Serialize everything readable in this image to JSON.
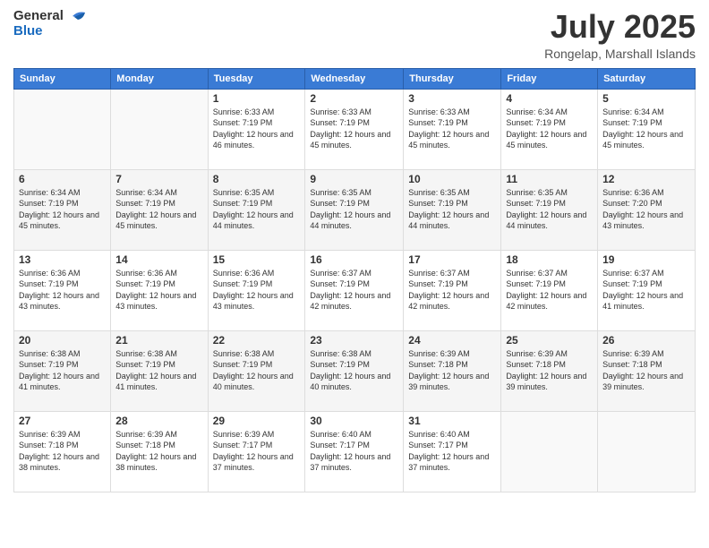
{
  "header": {
    "logo_general": "General",
    "logo_blue": "Blue",
    "month_title": "July 2025",
    "location": "Rongelap, Marshall Islands"
  },
  "days_of_week": [
    "Sunday",
    "Monday",
    "Tuesday",
    "Wednesday",
    "Thursday",
    "Friday",
    "Saturday"
  ],
  "weeks": [
    [
      {
        "day": "",
        "info": ""
      },
      {
        "day": "",
        "info": ""
      },
      {
        "day": "1",
        "info": "Sunrise: 6:33 AM\nSunset: 7:19 PM\nDaylight: 12 hours and 46 minutes."
      },
      {
        "day": "2",
        "info": "Sunrise: 6:33 AM\nSunset: 7:19 PM\nDaylight: 12 hours and 45 minutes."
      },
      {
        "day": "3",
        "info": "Sunrise: 6:33 AM\nSunset: 7:19 PM\nDaylight: 12 hours and 45 minutes."
      },
      {
        "day": "4",
        "info": "Sunrise: 6:34 AM\nSunset: 7:19 PM\nDaylight: 12 hours and 45 minutes."
      },
      {
        "day": "5",
        "info": "Sunrise: 6:34 AM\nSunset: 7:19 PM\nDaylight: 12 hours and 45 minutes."
      }
    ],
    [
      {
        "day": "6",
        "info": "Sunrise: 6:34 AM\nSunset: 7:19 PM\nDaylight: 12 hours and 45 minutes."
      },
      {
        "day": "7",
        "info": "Sunrise: 6:34 AM\nSunset: 7:19 PM\nDaylight: 12 hours and 45 minutes."
      },
      {
        "day": "8",
        "info": "Sunrise: 6:35 AM\nSunset: 7:19 PM\nDaylight: 12 hours and 44 minutes."
      },
      {
        "day": "9",
        "info": "Sunrise: 6:35 AM\nSunset: 7:19 PM\nDaylight: 12 hours and 44 minutes."
      },
      {
        "day": "10",
        "info": "Sunrise: 6:35 AM\nSunset: 7:19 PM\nDaylight: 12 hours and 44 minutes."
      },
      {
        "day": "11",
        "info": "Sunrise: 6:35 AM\nSunset: 7:19 PM\nDaylight: 12 hours and 44 minutes."
      },
      {
        "day": "12",
        "info": "Sunrise: 6:36 AM\nSunset: 7:20 PM\nDaylight: 12 hours and 43 minutes."
      }
    ],
    [
      {
        "day": "13",
        "info": "Sunrise: 6:36 AM\nSunset: 7:19 PM\nDaylight: 12 hours and 43 minutes."
      },
      {
        "day": "14",
        "info": "Sunrise: 6:36 AM\nSunset: 7:19 PM\nDaylight: 12 hours and 43 minutes."
      },
      {
        "day": "15",
        "info": "Sunrise: 6:36 AM\nSunset: 7:19 PM\nDaylight: 12 hours and 43 minutes."
      },
      {
        "day": "16",
        "info": "Sunrise: 6:37 AM\nSunset: 7:19 PM\nDaylight: 12 hours and 42 minutes."
      },
      {
        "day": "17",
        "info": "Sunrise: 6:37 AM\nSunset: 7:19 PM\nDaylight: 12 hours and 42 minutes."
      },
      {
        "day": "18",
        "info": "Sunrise: 6:37 AM\nSunset: 7:19 PM\nDaylight: 12 hours and 42 minutes."
      },
      {
        "day": "19",
        "info": "Sunrise: 6:37 AM\nSunset: 7:19 PM\nDaylight: 12 hours and 41 minutes."
      }
    ],
    [
      {
        "day": "20",
        "info": "Sunrise: 6:38 AM\nSunset: 7:19 PM\nDaylight: 12 hours and 41 minutes."
      },
      {
        "day": "21",
        "info": "Sunrise: 6:38 AM\nSunset: 7:19 PM\nDaylight: 12 hours and 41 minutes."
      },
      {
        "day": "22",
        "info": "Sunrise: 6:38 AM\nSunset: 7:19 PM\nDaylight: 12 hours and 40 minutes."
      },
      {
        "day": "23",
        "info": "Sunrise: 6:38 AM\nSunset: 7:19 PM\nDaylight: 12 hours and 40 minutes."
      },
      {
        "day": "24",
        "info": "Sunrise: 6:39 AM\nSunset: 7:18 PM\nDaylight: 12 hours and 39 minutes."
      },
      {
        "day": "25",
        "info": "Sunrise: 6:39 AM\nSunset: 7:18 PM\nDaylight: 12 hours and 39 minutes."
      },
      {
        "day": "26",
        "info": "Sunrise: 6:39 AM\nSunset: 7:18 PM\nDaylight: 12 hours and 39 minutes."
      }
    ],
    [
      {
        "day": "27",
        "info": "Sunrise: 6:39 AM\nSunset: 7:18 PM\nDaylight: 12 hours and 38 minutes."
      },
      {
        "day": "28",
        "info": "Sunrise: 6:39 AM\nSunset: 7:18 PM\nDaylight: 12 hours and 38 minutes."
      },
      {
        "day": "29",
        "info": "Sunrise: 6:39 AM\nSunset: 7:17 PM\nDaylight: 12 hours and 37 minutes."
      },
      {
        "day": "30",
        "info": "Sunrise: 6:40 AM\nSunset: 7:17 PM\nDaylight: 12 hours and 37 minutes."
      },
      {
        "day": "31",
        "info": "Sunrise: 6:40 AM\nSunset: 7:17 PM\nDaylight: 12 hours and 37 minutes."
      },
      {
        "day": "",
        "info": ""
      },
      {
        "day": "",
        "info": ""
      }
    ]
  ]
}
